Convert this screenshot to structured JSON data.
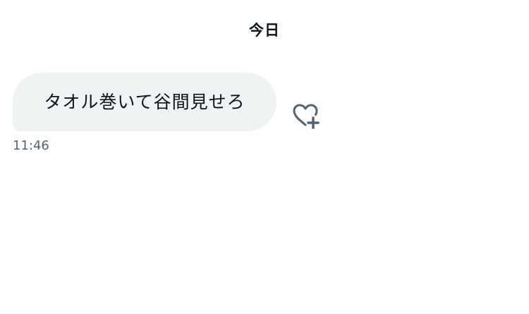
{
  "conversation": {
    "date_divider": "今日",
    "messages": [
      {
        "text": "タオル巻いて谷間見せろ",
        "time": "11:46",
        "reaction_icon": "heart-plus-icon"
      }
    ]
  },
  "colors": {
    "bubble_bg": "#eff3f4",
    "text": "#0f1419",
    "muted": "#536471"
  }
}
